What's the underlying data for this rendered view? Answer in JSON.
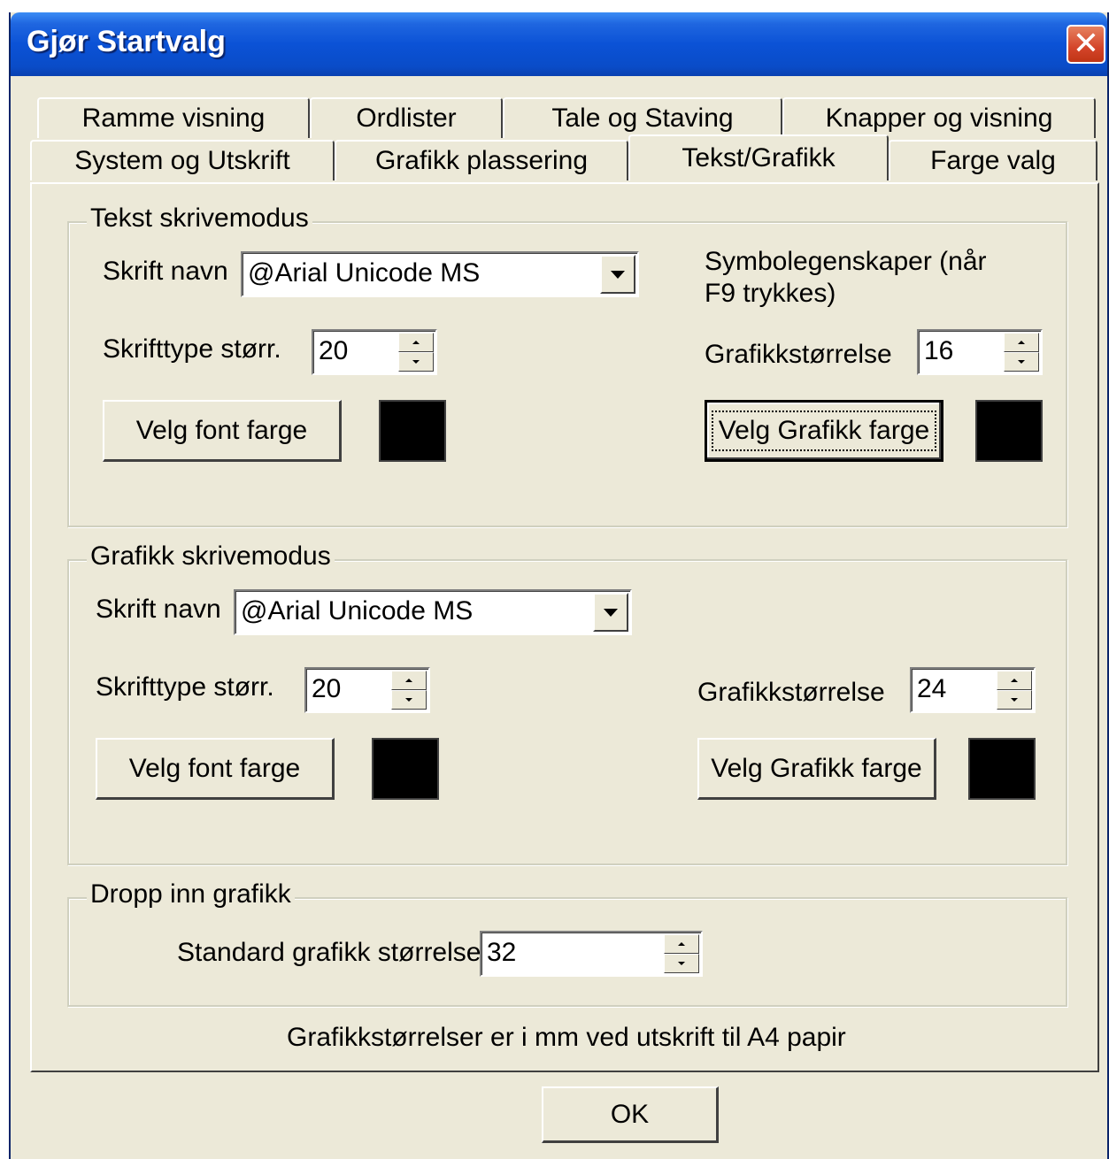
{
  "window": {
    "title": "Gjør Startvalg",
    "close_icon": "close-icon"
  },
  "tabs": {
    "row1": [
      "Ramme visning",
      "Ordlister",
      "Tale og Staving",
      "Knapper og visning"
    ],
    "row2": [
      "System og Utskrift",
      "Grafikk plassering",
      "Tekst/Grafikk",
      "Farge valg"
    ],
    "active": "Tekst/Grafikk"
  },
  "text_mode": {
    "group_label": "Tekst skrivemodus",
    "font_name_label": "Skrift navn",
    "font_name_value": "@Arial Unicode MS",
    "font_size_label": "Skrifttype størr.",
    "font_size_value": "20",
    "font_color_button": "Velg font farge",
    "font_color": "#000000",
    "symbol_props_label": "Symbolegenskaper (når F9 trykkes)",
    "graphic_size_label": "Grafikkstørrelse",
    "graphic_size_value": "16",
    "graphic_color_button": "Velg Grafikk farge",
    "graphic_color": "#000000"
  },
  "graphic_mode": {
    "group_label": "Grafikk skrivemodus",
    "font_name_label": "Skrift navn",
    "font_name_value": "@Arial Unicode MS",
    "font_size_label": "Skrifttype størr.",
    "font_size_value": "20",
    "font_color_button": "Velg font farge",
    "font_color": "#000000",
    "graphic_size_label": "Grafikkstørrelse",
    "graphic_size_value": "24",
    "graphic_color_button": "Velg Grafikk farge",
    "graphic_color": "#000000"
  },
  "drop_in": {
    "group_label": "Dropp inn grafikk",
    "standard_size_label": "Standard grafikk størrelse",
    "standard_size_value": "32"
  },
  "footnote": "Grafikkstørrelser er i mm ved utskrift til A4 papir",
  "ok_button": "OK"
}
